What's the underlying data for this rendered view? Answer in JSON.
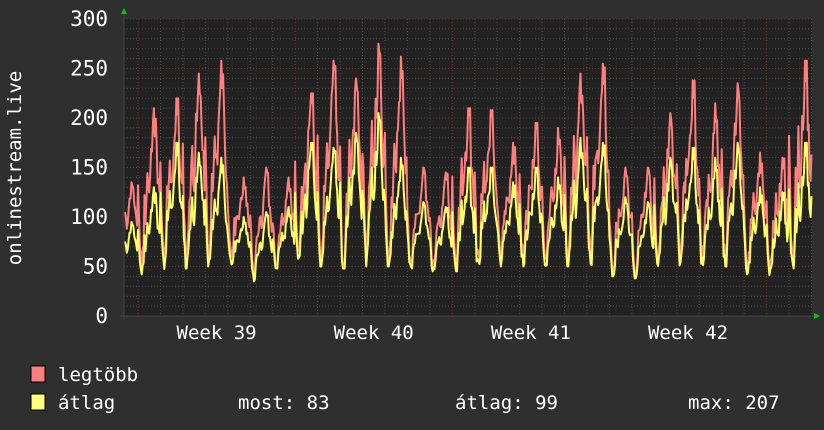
{
  "chart_data": {
    "type": "line",
    "ylabel": "onlinestream.live",
    "ylim": [
      0,
      300
    ],
    "yticks": [
      "0",
      "50",
      "100",
      "150",
      "200",
      "250",
      "300"
    ],
    "xticks": [
      "Week 39",
      "Week 40",
      "Week 41",
      "Week 42"
    ],
    "x_unit": "day",
    "grid": true,
    "legend_placement": "bottom-left",
    "series": [
      {
        "name": "legtöbb",
        "color": "#ff7f7f",
        "daily_peak": [
          135,
          210,
          220,
          245,
          258,
          140,
          150,
          140,
          225,
          258,
          240,
          275,
          262,
          150,
          145,
          210,
          208,
          175,
          195,
          190,
          245,
          255,
          150,
          150,
          205,
          238,
          215,
          235,
          165,
          160,
          258,
          230
        ],
        "daily_min": [
          55,
          50,
          52,
          55,
          58,
          60,
          38,
          52,
          55,
          55,
          52,
          55,
          55,
          52,
          50,
          50,
          52,
          55,
          55,
          50,
          55,
          55,
          45,
          42,
          52,
          55,
          50,
          55,
          48,
          45,
          52,
          55
        ]
      },
      {
        "name": "átlag",
        "color": "#ffff66",
        "daily_peak": [
          95,
          130,
          175,
          165,
          160,
          100,
          105,
          110,
          175,
          170,
          185,
          205,
          160,
          115,
          110,
          150,
          150,
          135,
          150,
          140,
          180,
          175,
          120,
          115,
          160,
          170,
          160,
          175,
          130,
          125,
          175,
          165
        ],
        "daily_min": [
          42,
          42,
          45,
          48,
          50,
          52,
          35,
          48,
          50,
          50,
          48,
          50,
          50,
          48,
          45,
          45,
          48,
          50,
          50,
          45,
          50,
          50,
          40,
          38,
          48,
          50,
          45,
          50,
          42,
          40,
          48,
          50
        ]
      }
    ],
    "legend": {
      "max_label": "legtöbb",
      "avg_label": "átlag",
      "now": "most: 83",
      "average": "átlag: 99",
      "maximum": "max: 207"
    }
  }
}
